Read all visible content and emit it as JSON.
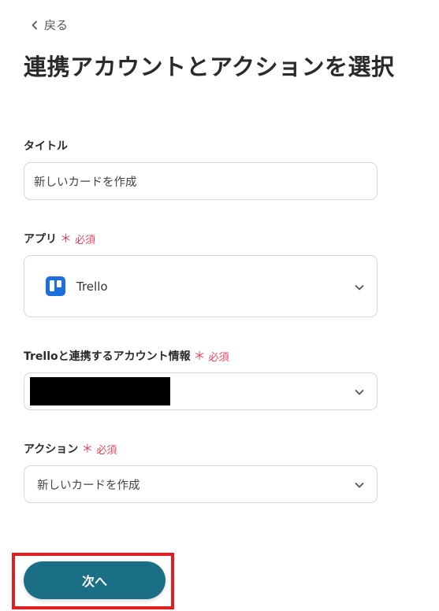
{
  "nav": {
    "back_label": "戻る"
  },
  "page_title": "連携アカウントとアクションを選択",
  "fields": {
    "title": {
      "label": "タイトル",
      "value": "新しいカードを作成"
    },
    "app": {
      "label": "アプリ",
      "required_mark": "＊",
      "required_text": "必須",
      "value": "Trello",
      "icon": "trello-icon"
    },
    "account": {
      "label": "Trelloと連携するアカウント情報",
      "required_mark": "＊",
      "required_text": "必須",
      "value_redacted": true
    },
    "action": {
      "label": "アクション",
      "required_mark": "＊",
      "required_text": "必須",
      "value": "新しいカードを作成"
    }
  },
  "next_button_label": "次へ",
  "colors": {
    "primary": "#1a6e85",
    "required": "#e0455a",
    "highlight": "#e02020",
    "trello": "#1d6fe0"
  }
}
